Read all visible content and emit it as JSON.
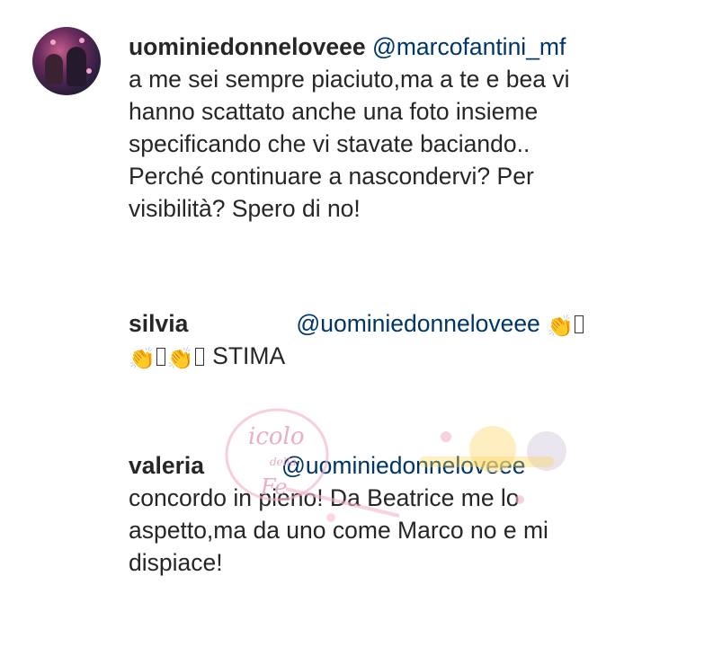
{
  "comments": [
    {
      "username": "uominiedonneloveee",
      "mention": "@marcofantini_mf",
      "lines": [
        "a me sei sempre piaciuto,ma a te e bea vi",
        "hanno scattato anche una foto insieme",
        "specificando che vi stavate baciando..",
        "Perché continuare a nascondervi? Per",
        "visibilità? Spero di no!"
      ],
      "avatar": "profile-photo"
    },
    {
      "username": "silvia",
      "mention": "@uominiedonneloveee",
      "text_after": "STIMA",
      "emoji": "clapping-hands"
    },
    {
      "username": "valeria",
      "mention": "@uominiedonneloveee",
      "lines": [
        "concordo in pieno! Da Beatrice me lo",
        "aspetto,ma da uno come Marco no e mi",
        "dispiace!"
      ]
    }
  ],
  "watermark": {
    "line1": "icolo",
    "line2": "della",
    "line3": "Fe"
  },
  "colors": {
    "text": "#262626",
    "mention": "#003569",
    "background": "#ffffff"
  }
}
